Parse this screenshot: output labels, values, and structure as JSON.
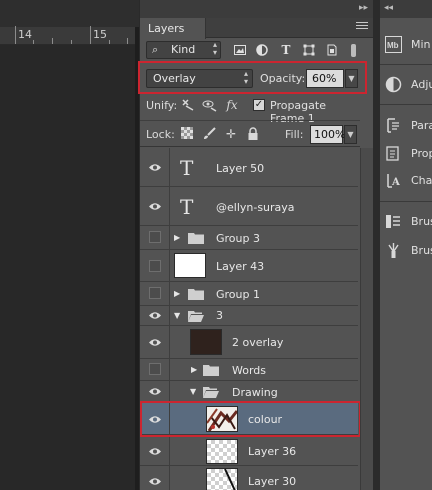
{
  "canvas": {
    "ruler_labels": [
      "14",
      "15"
    ]
  },
  "layers_panel": {
    "tab_label": "Layers",
    "filter": {
      "kind_label": "Kind"
    },
    "blend_mode": "Overlay",
    "opacity_label": "Opacity:",
    "opacity_value": "60%",
    "unify_label": "Unify:",
    "propagate_label": "Propagate Frame 1",
    "propagate_checked": true,
    "lock_label": "Lock:",
    "fill_label": "Fill:",
    "fill_value": "100%",
    "layers": [
      {
        "name": "Layer 50",
        "kind": "type",
        "visible": true
      },
      {
        "name": "@ellyn-suraya",
        "kind": "type",
        "visible": true
      },
      {
        "name": "Group 3",
        "kind": "group",
        "visible": false,
        "expanded": false
      },
      {
        "name": "Layer 43",
        "kind": "pixel",
        "thumb": "white",
        "visible": false
      },
      {
        "name": "Group 1",
        "kind": "group",
        "visible": false,
        "expanded": false
      },
      {
        "name": "3",
        "kind": "group",
        "visible": true,
        "expanded": true
      },
      {
        "name": "2 overlay",
        "kind": "pixel",
        "thumb": "dark",
        "visible": true
      },
      {
        "name": "Words",
        "kind": "group",
        "visible": false,
        "expanded": false
      },
      {
        "name": "Drawing",
        "kind": "group",
        "visible": true,
        "expanded": true
      },
      {
        "name": "colour",
        "kind": "pixel",
        "thumb": "sketch",
        "visible": true,
        "selected": true
      },
      {
        "name": "Layer 36",
        "kind": "pixel",
        "thumb": "transparent",
        "visible": true
      },
      {
        "name": "Layer 30",
        "kind": "pixel",
        "thumb": "transparent-line",
        "visible": true
      }
    ]
  },
  "side_dock": {
    "items": [
      {
        "label": "Min",
        "icon": "mini-bridge-icon"
      },
      {
        "label": "Adju",
        "icon": "adjustments-icon"
      },
      {
        "label": "Para",
        "icon": "paragraph-icon"
      },
      {
        "label": "Prop",
        "icon": "properties-icon"
      },
      {
        "label": "Cha",
        "icon": "character-icon"
      },
      {
        "label": "Brus",
        "icon": "brush-icon"
      },
      {
        "label": "Brus",
        "icon": "brush-presets-icon"
      }
    ]
  },
  "colors": {
    "highlight": "#cc2530",
    "selected_row": "#5a6b7f",
    "panel_bg": "#535353"
  }
}
